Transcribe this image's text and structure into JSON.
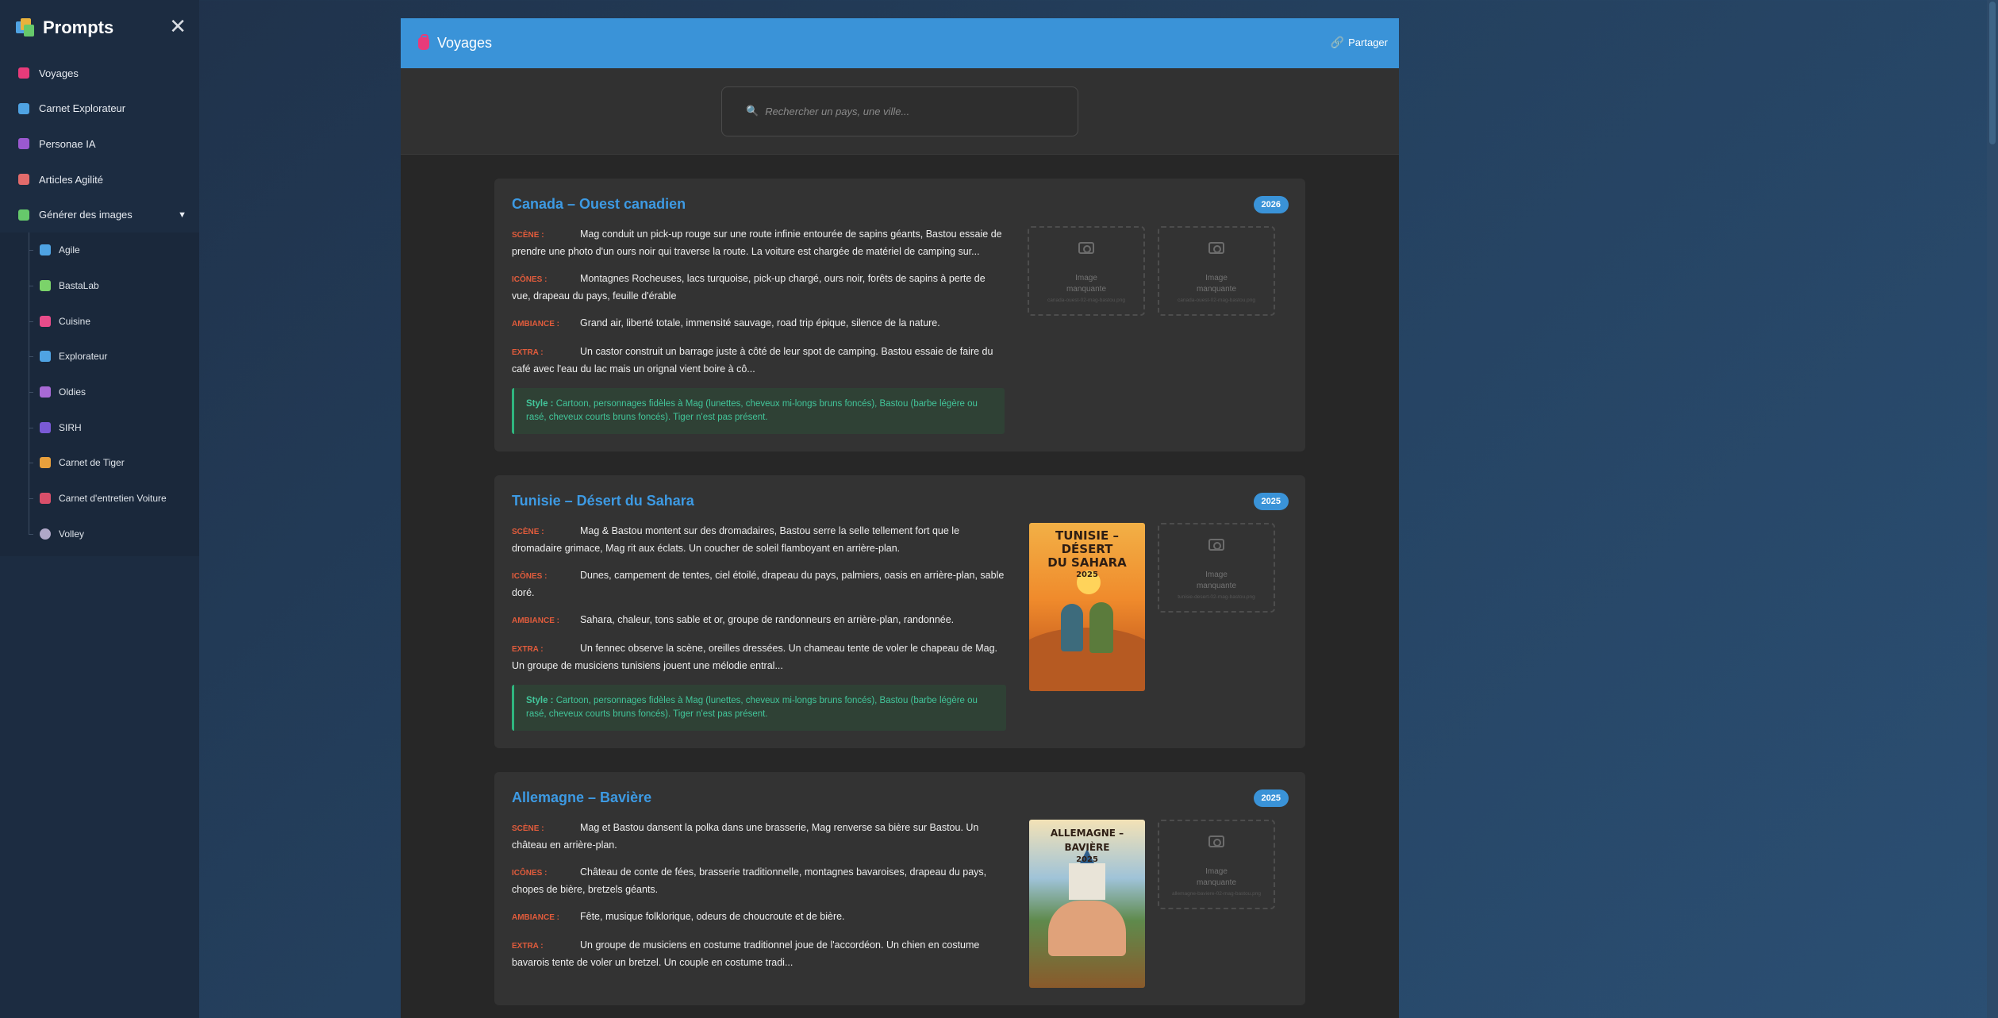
{
  "sidebar": {
    "title": "Prompts",
    "close_symbol": "✕",
    "items": [
      {
        "label": "Voyages",
        "icon": "bag-icon",
        "color": "#e83b7a"
      },
      {
        "label": "Carnet Explorateur",
        "icon": "map-icon",
        "color": "#4fa3e3"
      },
      {
        "label": "Personae IA",
        "icon": "person-icon",
        "color": "#9b59d0"
      },
      {
        "label": "Articles Agilité",
        "icon": "document-icon",
        "color": "#e26b6b"
      },
      {
        "label": "Générer des images",
        "icon": "picture-icon",
        "color": "#66c96b",
        "caret": "▼"
      }
    ],
    "subitems": [
      {
        "label": "Agile",
        "icon": "cycle-icon",
        "color": "#4fa3e3"
      },
      {
        "label": "BastaLab",
        "icon": "pencil-icon",
        "color": "#7bd36a"
      },
      {
        "label": "Cuisine",
        "icon": "cooking-icon",
        "color": "#e84c8a"
      },
      {
        "label": "Explorateur",
        "icon": "map-icon",
        "color": "#4fa3e3"
      },
      {
        "label": "Oldies",
        "icon": "radio-icon",
        "color": "#a86ad6"
      },
      {
        "label": "SIRH",
        "icon": "people-icon",
        "color": "#7a5ad6"
      },
      {
        "label": "Carnet de Tiger",
        "icon": "tiger-icon",
        "color": "#e8a03c"
      },
      {
        "label": "Carnet d'entretien Voiture",
        "icon": "car-icon",
        "color": "#d94f6a"
      },
      {
        "label": "Volley",
        "icon": "volleyball-icon",
        "color": "#b0a8c8"
      }
    ]
  },
  "header": {
    "title": "Voyages",
    "share_label": "Partager",
    "share_symbol": "🔗"
  },
  "search": {
    "placeholder": "Rechercher un pays, une ville...",
    "icon_symbol": "🔍"
  },
  "labels": {
    "scene": "SCÈNE :",
    "icones": "ICÔNES :",
    "ambiance": "AMBIANCE :",
    "extra": "EXTRA :",
    "style": "Style :",
    "missing_line1": "Image",
    "missing_line2": "manquante"
  },
  "cards": [
    {
      "title": "Canada – Ouest canadien",
      "year": "2026",
      "scene": "Mag conduit un pick-up rouge sur une route infinie entourée de sapins géants, Bastou essaie de prendre une photo d'un ours noir qui traverse la route. La voiture est chargée de matériel de camping sur...",
      "icones": "Montagnes Rocheuses, lacs turquoise, pick-up chargé, ours noir, forêts de sapins à perte de vue, drapeau du pays, feuille d'érable",
      "ambiance": "Grand air, liberté totale, immensité sauvage, road trip épique, silence de la nature.",
      "extra": "Un castor construit un barrage juste à côté de leur spot de camping. Bastou essaie de faire du café avec l'eau du lac mais un orignal vient boire à cô...",
      "style": "Cartoon, personnages fidèles à Mag (lunettes, cheveux mi-longs bruns foncés), Bastou (barbe légère ou rasé, cheveux courts bruns foncés). Tiger n'est pas présent.",
      "image1_file": "canada-ouest-02-mag-bastou.png",
      "image2_file": "canada-ouest-02-mag-bastou.png"
    },
    {
      "title": "Tunisie – Désert du Sahara",
      "year": "2025",
      "scene": "Mag & Bastou montent sur des dromadaires, Bastou serre la selle tellement fort que le dromadaire grimace, Mag rit aux éclats. Un coucher de soleil flamboyant en arrière-plan.",
      "icones": "Dunes, campement de tentes, ciel étoilé, drapeau du pays, palmiers, oasis en arrière-plan, sable doré.",
      "ambiance": "Sahara, chaleur, tons sable et or, groupe de randonneurs en arrière-plan, randonnée.",
      "extra": "Un fennec observe la scène, oreilles dressées. Un chameau tente de voler le chapeau de Mag. Un groupe de musiciens tunisiens jouent une mélodie entral...",
      "style": "Cartoon, personnages fidèles à Mag (lunettes, cheveux mi-longs bruns foncés), Bastou (barbe légère ou rasé, cheveux courts bruns foncés). Tiger n'est pas présent.",
      "poster_title_1": "TUNISIE – DÉSERT",
      "poster_title_2": "DU SAHARA",
      "poster_year": "2025",
      "image2_file": "tunisie-desert-02-mag-bastou.png"
    },
    {
      "title": "Allemagne – Bavière",
      "year": "2025",
      "scene": "Mag et Bastou dansent la polka dans une brasserie, Mag renverse sa bière sur Bastou. Un château en arrière-plan.",
      "icones": "Château de conte de fées, brasserie traditionnelle, montagnes bavaroises, drapeau du pays, chopes de bière, bretzels géants.",
      "ambiance": "Fête, musique folklorique, odeurs de choucroute et de bière.",
      "extra": "Un groupe de musiciens en costume traditionnel joue de l'accordéon. Un chien en costume bavarois tente de voler un bretzel. Un couple en costume tradi...",
      "poster_title_1": "ALLEMAGNE – BAVIÈRE",
      "poster_year": "2025",
      "image2_file": "allemagne-baviere-02-mag-bastou.png"
    }
  ]
}
